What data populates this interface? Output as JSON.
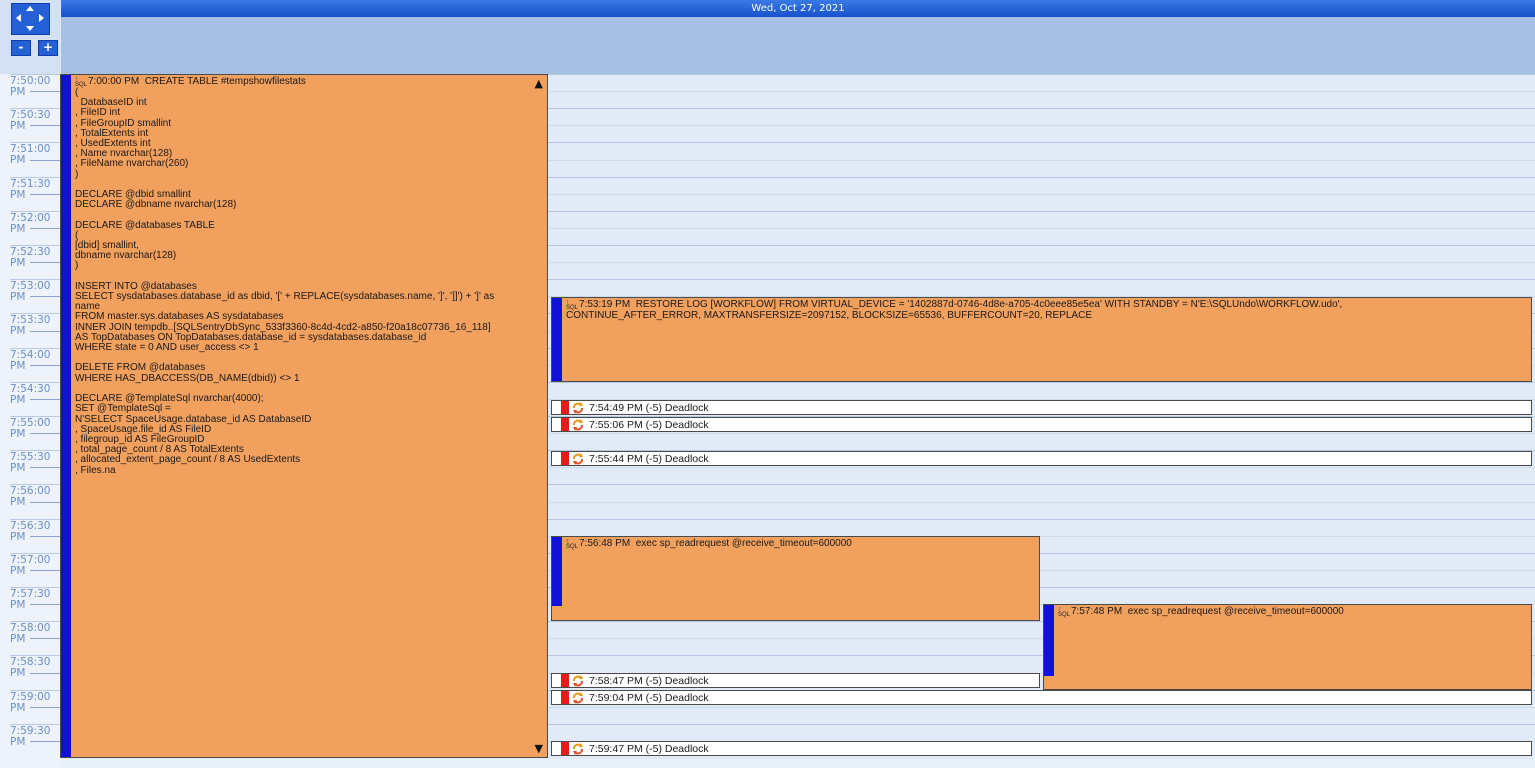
{
  "header": {
    "date": "Wed, Oct 27, 2021"
  },
  "nav": {
    "zoom_out": "-",
    "zoom_in": "+"
  },
  "time_slots": [
    {
      "time": "7:50:00",
      "ampm": "PM"
    },
    {
      "time": "7:50:30",
      "ampm": "PM"
    },
    {
      "time": "7:51:00",
      "ampm": "PM"
    },
    {
      "time": "7:51:30",
      "ampm": "PM"
    },
    {
      "time": "7:52:00",
      "ampm": "PM"
    },
    {
      "time": "7:52:30",
      "ampm": "PM"
    },
    {
      "time": "7:53:00",
      "ampm": "PM"
    },
    {
      "time": "7:53:30",
      "ampm": "PM"
    },
    {
      "time": "7:54:00",
      "ampm": "PM"
    },
    {
      "time": "7:54:30",
      "ampm": "PM"
    },
    {
      "time": "7:55:00",
      "ampm": "PM"
    },
    {
      "time": "7:55:30",
      "ampm": "PM"
    },
    {
      "time": "7:56:00",
      "ampm": "PM"
    },
    {
      "time": "7:56:30",
      "ampm": "PM"
    },
    {
      "time": "7:57:00",
      "ampm": "PM"
    },
    {
      "time": "7:57:30",
      "ampm": "PM"
    },
    {
      "time": "7:58:00",
      "ampm": "PM"
    },
    {
      "time": "7:58:30",
      "ampm": "PM"
    },
    {
      "time": "7:59:00",
      "ampm": "PM"
    },
    {
      "time": "7:59:30",
      "ampm": "PM"
    }
  ],
  "events": {
    "create_table": {
      "icon": "sql-icon",
      "text": "7:00:00 PM  CREATE TABLE #tempshowfilestats\n(\n  DatabaseID int\n, FileID int\n, FileGroupID smallint\n, TotalExtents int\n, UsedExtents int\n, Name nvarchar(128)\n, FileName nvarchar(260)\n)\n\nDECLARE @dbid smallint\nDECLARE @dbname nvarchar(128)\n\nDECLARE @databases TABLE\n(\n[dbid] smallint,\ndbname nvarchar(128)\n)\n\nINSERT INTO @databases\nSELECT sysdatabases.database_id as dbid, '[' + REPLACE(sysdatabases.name, ']', ']]') + ']' as\nname\nFROM master.sys.databases AS sysdatabases\nINNER JOIN tempdb..[SQLSentryDbSync_533f3360-8c4d-4cd2-a850-f20a18c07736_16_118]\nAS TopDatabases ON TopDatabases.database_id = sysdatabases.database_id\nWHERE state = 0 AND user_access <> 1\n\nDELETE FROM @databases\nWHERE HAS_DBACCESS(DB_NAME(dbid)) <> 1\n\nDECLARE @TemplateSql nvarchar(4000);\nSET @TemplateSql =\nN'SELECT SpaceUsage.database_id AS DatabaseID\n, SpaceUsage.file_id AS FileID\n, filegroup_id AS FileGroupID\n, total_page_count / 8 AS TotalExtents\n, allocated_extent_page_count / 8 AS UsedExtents\n, Files.na",
      "scroll_up": "▲",
      "scroll_down": "▼"
    },
    "restore_log": {
      "icon": "sql-icon",
      "text": "7:53:19 PM  RESTORE LOG [WORKFLOW] FROM VIRTUAL_DEVICE = '1402887d-0746-4d8e-a705-4c0eee85e5ea' WITH STANDBY = N'E:\\SQLUndo\\WORKFLOW.udo',\nCONTINUE_AFTER_ERROR, MAXTRANSFERSIZE=2097152, BLOCKSIZE=65536, BUFFERCOUNT=20, REPLACE"
    },
    "readrequest_1": {
      "icon": "sql-icon",
      "text": "7:56:48 PM  exec sp_readrequest @receive_timeout=600000"
    },
    "readrequest_2": {
      "icon": "sql-icon",
      "text": "7:57:48 PM  exec sp_readrequest @receive_timeout=600000"
    },
    "deadlocks": [
      {
        "label": "7:54:49 PM (-5)  Deadlock"
      },
      {
        "label": "7:55:06 PM (-5)  Deadlock"
      },
      {
        "label": "7:55:44 PM (-5)  Deadlock"
      },
      {
        "label": "7:58:47 PM (-5)  Deadlock"
      },
      {
        "label": "7:59:04 PM (-5)  Deadlock"
      },
      {
        "label": "7:59:47 PM (-5)  Deadlock"
      }
    ]
  },
  "colors": {
    "event_fill": "#f2a05e",
    "event_bar": "#1010d8",
    "deadlock_red": "#e31c1c",
    "header_blue": "#2a66dc"
  }
}
